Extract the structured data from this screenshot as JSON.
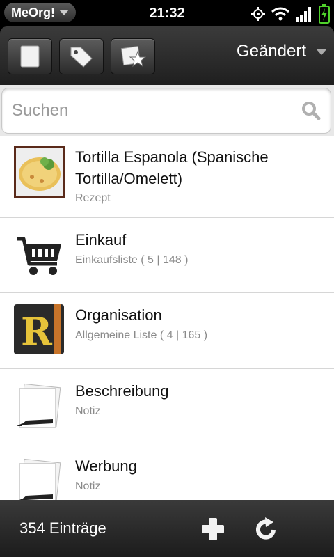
{
  "status_bar": {
    "app_menu": "MeOrg!",
    "clock": "21:32"
  },
  "header": {
    "sort_label": "Geändert"
  },
  "search": {
    "placeholder": "Suchen"
  },
  "items": [
    {
      "title": "Tortilla Espanola (Spanische Tortilla/Omelett)",
      "subtitle": "Rezept",
      "icon": "recipe-photo-icon"
    },
    {
      "title": "Einkauf",
      "subtitle": "Einkaufsliste ( 5 | 148 )",
      "icon": "shopping-cart-icon"
    },
    {
      "title": "Organisation",
      "subtitle": "Allgemeine Liste ( 4 | 165 )",
      "icon": "r-book-icon"
    },
    {
      "title": "Beschreibung",
      "subtitle": "Notiz",
      "icon": "note-pen-icon"
    },
    {
      "title": "Werbung",
      "subtitle": "Notiz",
      "icon": "note-pen-icon"
    }
  ],
  "footer": {
    "count": "354 Einträge"
  }
}
